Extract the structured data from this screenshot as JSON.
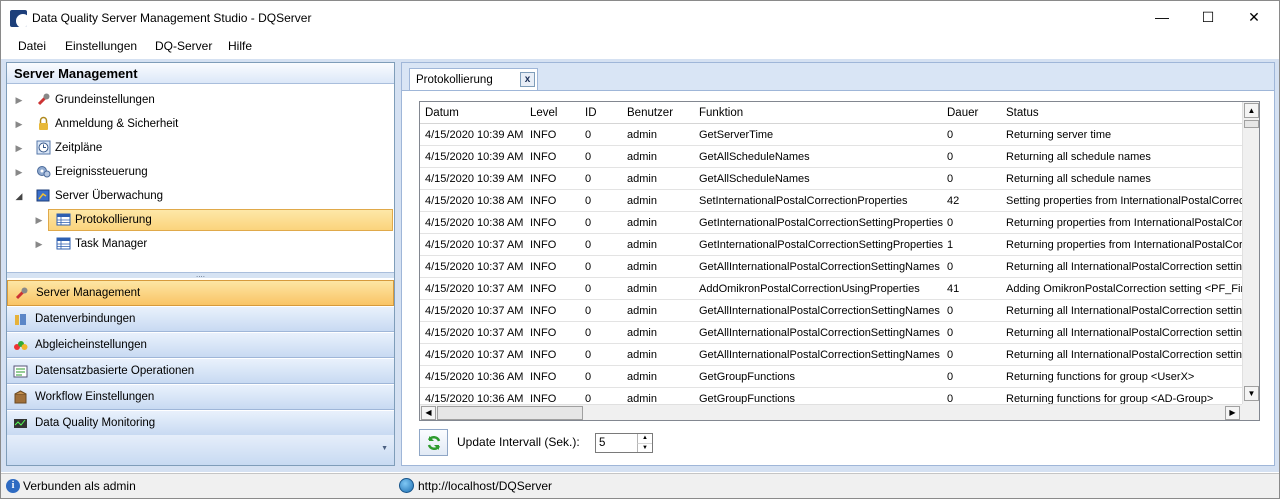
{
  "window": {
    "title": "Data Quality Server Management Studio - DQServer",
    "minimize_glyph": "—",
    "maximize_glyph": "☐",
    "close_glyph": "✕"
  },
  "menu": {
    "items": [
      "Datei",
      "Einstellungen",
      "DQ-Server",
      "Hilfe"
    ]
  },
  "left_panel": {
    "header": "Server Management",
    "tree": [
      {
        "label": "Grundeinstellungen",
        "icon": "wrench-icon",
        "expanded": false
      },
      {
        "label": "Anmeldung & Sicherheit",
        "icon": "lock-icon",
        "expanded": false
      },
      {
        "label": "Zeitpläne",
        "icon": "clock-icon",
        "expanded": false
      },
      {
        "label": "Ereignissteuerung",
        "icon": "gears-icon",
        "expanded": false
      },
      {
        "label": "Server Überwachung",
        "icon": "monitor-icon",
        "expanded": true,
        "children": [
          {
            "label": "Protokollierung",
            "icon": "table-icon",
            "selected": true
          },
          {
            "label": "Task Manager",
            "icon": "table-icon",
            "selected": false
          }
        ]
      }
    ],
    "splitter_grip": "....",
    "nav_buttons": [
      {
        "label": "Server Management",
        "icon": "wrench-icon",
        "active": true
      },
      {
        "label": "Datenverbindungen",
        "icon": "database-icon",
        "active": false
      },
      {
        "label": "Abgleicheinstellungen",
        "icon": "colored-dots-icon",
        "active": false
      },
      {
        "label": "Datensatzbasierte Operationen",
        "icon": "records-icon",
        "active": false
      },
      {
        "label": "Workflow Einstellungen",
        "icon": "package-icon",
        "active": false
      },
      {
        "label": "Data Quality Monitoring",
        "icon": "monitoring-icon",
        "active": false
      }
    ],
    "nav_footer_arrow": "▼"
  },
  "tab": {
    "label": "Protokollierung",
    "close_label": "x"
  },
  "log_table": {
    "columns": [
      "Datum",
      "Level",
      "ID",
      "Benutzer",
      "Funktion",
      "Dauer",
      "Status"
    ],
    "rows": [
      [
        "4/15/2020 10:39 AM",
        "INFO",
        "0",
        "admin",
        "GetServerTime",
        "0",
        "Returning server time"
      ],
      [
        "4/15/2020 10:39 AM",
        "INFO",
        "0",
        "admin",
        "GetAllScheduleNames",
        "0",
        "Returning all schedule names"
      ],
      [
        "4/15/2020 10:39 AM",
        "INFO",
        "0",
        "admin",
        "GetAllScheduleNames",
        "0",
        "Returning all schedule names"
      ],
      [
        "4/15/2020 10:38 AM",
        "INFO",
        "0",
        "admin",
        "SetInternationalPostalCorrectionProperties",
        "42",
        "Setting properties from InternationalPostalCorrec"
      ],
      [
        "4/15/2020 10:38 AM",
        "INFO",
        "0",
        "admin",
        "GetInternationalPostalCorrectionSettingProperties",
        "0",
        "Returning properties from InternationalPostalCor"
      ],
      [
        "4/15/2020 10:37 AM",
        "INFO",
        "0",
        "admin",
        "GetInternationalPostalCorrectionSettingProperties",
        "1",
        "Returning properties from InternationalPostalCor"
      ],
      [
        "4/15/2020 10:37 AM",
        "INFO",
        "0",
        "admin",
        "GetAllInternationalPostalCorrectionSettingNames",
        "0",
        "Returning all InternationalPostalCorrection setting"
      ],
      [
        "4/15/2020 10:37 AM",
        "INFO",
        "0",
        "admin",
        "AddOmikronPostalCorrectionUsingProperties",
        "41",
        "Adding OmikronPostalCorrection setting <PF_Firm"
      ],
      [
        "4/15/2020 10:37 AM",
        "INFO",
        "0",
        "admin",
        "GetAllInternationalPostalCorrectionSettingNames",
        "0",
        "Returning all InternationalPostalCorrection setting"
      ],
      [
        "4/15/2020 10:37 AM",
        "INFO",
        "0",
        "admin",
        "GetAllInternationalPostalCorrectionSettingNames",
        "0",
        "Returning all InternationalPostalCorrection setting"
      ],
      [
        "4/15/2020 10:37 AM",
        "INFO",
        "0",
        "admin",
        "GetAllInternationalPostalCorrectionSettingNames",
        "0",
        "Returning all InternationalPostalCorrection setting"
      ],
      [
        "4/15/2020 10:36 AM",
        "INFO",
        "0",
        "admin",
        "GetGroupFunctions",
        "0",
        "Returning functions for group <UserX>"
      ],
      [
        "4/15/2020 10:36 AM",
        "INFO",
        "0",
        "admin",
        "GetGroupFunctions",
        "0",
        "Returning functions for group <AD-Group>"
      ]
    ],
    "scroll_up": "▲",
    "scroll_down": "▼",
    "scroll_left": "◀",
    "scroll_right": "▶"
  },
  "controls": {
    "interval_label": "Update Intervall (Sek.):",
    "interval_value": "5",
    "spin_up": "▲",
    "spin_down": "▼"
  },
  "status": {
    "connection": "Verbunden als admin",
    "info_glyph": "i",
    "url": "http://localhost/DQServer"
  },
  "colors": {
    "accent_blue": "#d5e1f2",
    "selection_orange": "#fbd47c",
    "refresh_green": "#2e9b2e"
  }
}
